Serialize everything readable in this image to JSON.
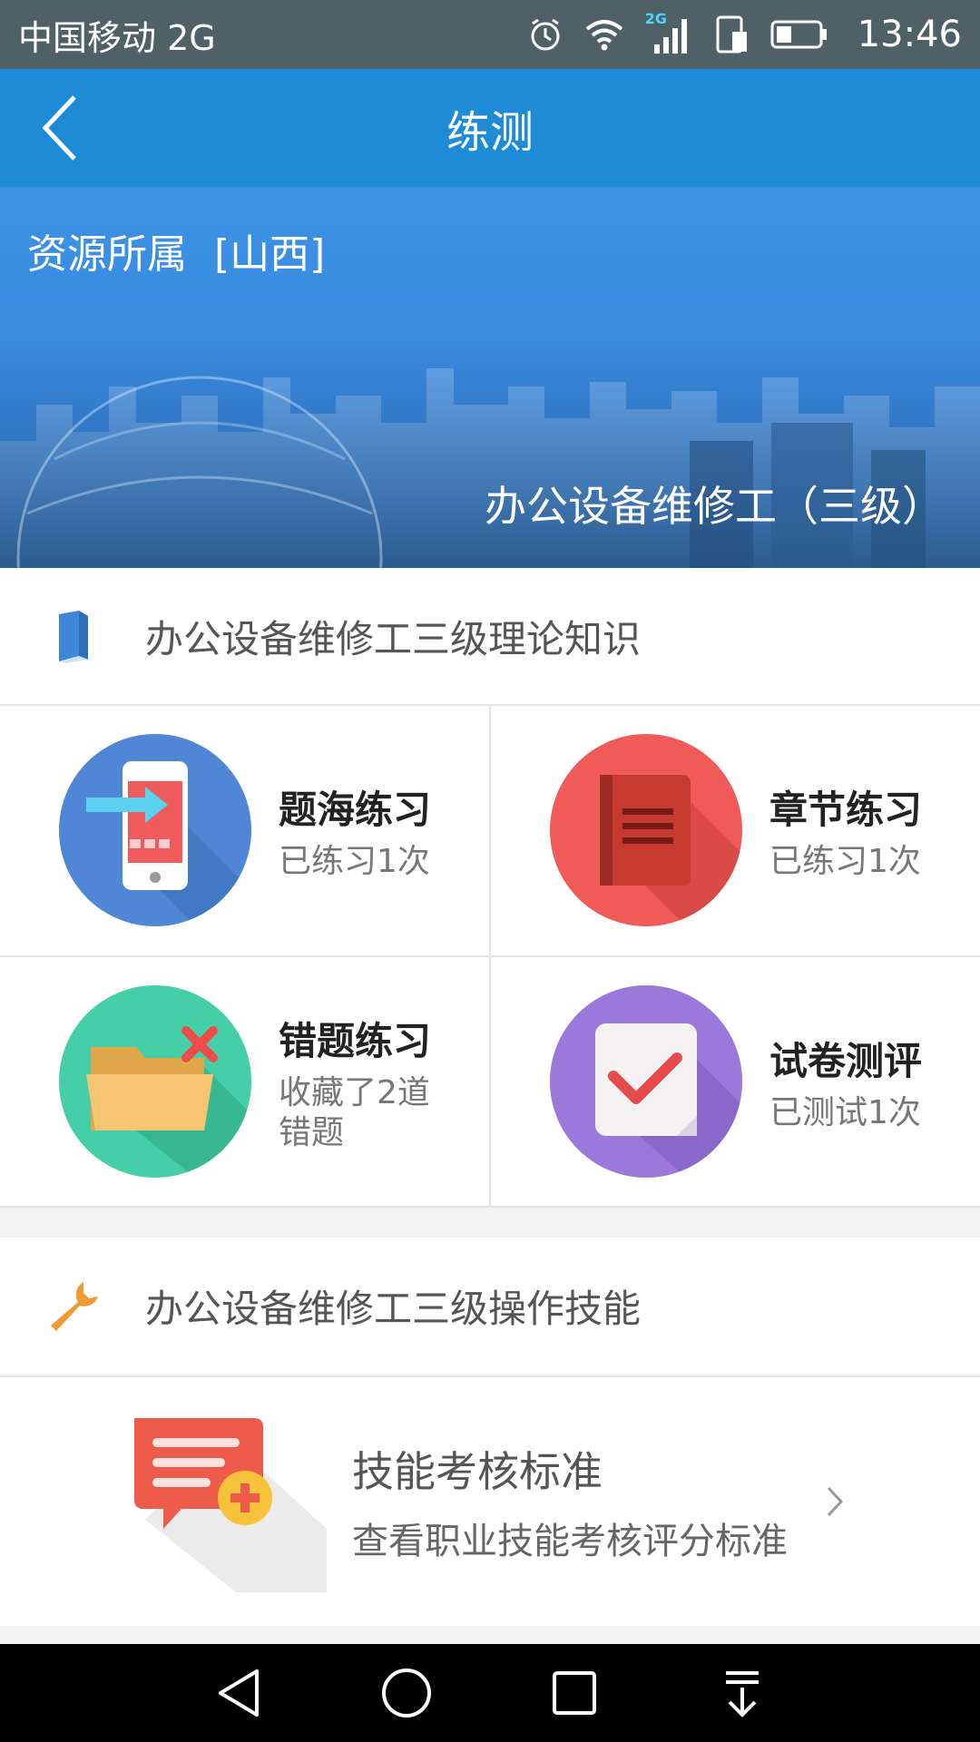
{
  "status_bar": {
    "carrier": "中国移动 2G",
    "network_badge": "2G",
    "time": "13:46",
    "icons": [
      "alarm-icon",
      "wifi-icon",
      "signal-icon",
      "sim-icon",
      "battery-icon"
    ]
  },
  "titlebar": {
    "title": "练测",
    "back_icon": "back-arrow-icon"
  },
  "banner": {
    "resource_label": "资源所属",
    "resource_value": "[山西]",
    "course_name": "办公设备维修工（三级）"
  },
  "theory_section": {
    "icon": "book-icon",
    "title": "办公设备维修工三级理论知识",
    "items": [
      {
        "name": "题海练习",
        "sub": "已练习1次",
        "icon": "phone-practice-icon",
        "color": "#4f87d6"
      },
      {
        "name": "章节练习",
        "sub": "已练习1次",
        "icon": "chapter-book-icon",
        "color": "#f05a57"
      },
      {
        "name": "错题练习",
        "sub": "收藏了2道错题",
        "icon": "wrong-folder-icon",
        "color": "#45cfa6"
      },
      {
        "name": "试卷测评",
        "sub": "已测试1次",
        "icon": "exam-check-icon",
        "color": "#9a79da"
      }
    ]
  },
  "skill_section": {
    "icon": "wrench-icon",
    "title": "办公设备维修工三级操作技能",
    "row": {
      "title": "技能考核标准",
      "subtitle": "查看职业技能考核评分标准",
      "icon": "standard-doc-icon"
    }
  },
  "nav_bar": {
    "buttons": [
      "back-triangle-icon",
      "home-circle-icon",
      "recents-square-icon",
      "notification-pull-icon"
    ]
  }
}
